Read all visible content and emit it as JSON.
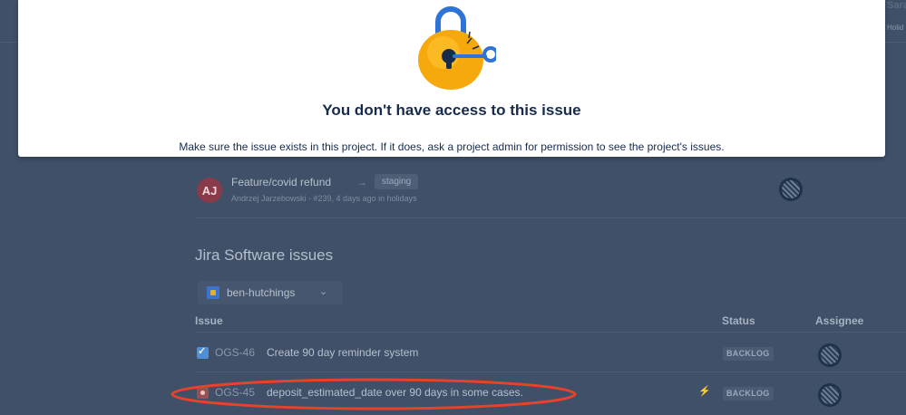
{
  "background": {
    "top_right_title": "Sarat",
    "top_right_subtitle": "Holid"
  },
  "dialog": {
    "title": "You don't have access to this issue",
    "body": "Make sure the issue exists in this project. If it does, ask a project admin for permission to see the project's issues.",
    "illustration": "lock-with-key-icon"
  },
  "pull_request": {
    "avatar_initials": "AJ",
    "title": "Feature/covid refund",
    "arrow": "→",
    "target_branch": "staging",
    "meta": "Andrzej Jarzebowski - #239, 4 days ago in holidays"
  },
  "jira": {
    "section_title": "Jira Software issues",
    "project_selector": "ben-hutchings",
    "columns": {
      "issue": "Issue",
      "status": "Status",
      "assignee": "Assignee"
    },
    "issues": [
      {
        "type": "task",
        "key": "OGS-46",
        "summary": "Create 90 day reminder system",
        "priority": "",
        "status": "BACKLOG"
      },
      {
        "type": "bug",
        "key": "OGS-45",
        "summary": "deposit_estimated_date over 90 days in some cases.",
        "priority": "⚡",
        "status": "BACKLOG"
      }
    ]
  },
  "colors": {
    "overlay_bg": "#3f5068",
    "dialog_bg": "#ffffff",
    "highlight_ellipse": "#e8422a",
    "lock_body": "#f6a90c",
    "lock_shackle": "#2f73d6"
  }
}
